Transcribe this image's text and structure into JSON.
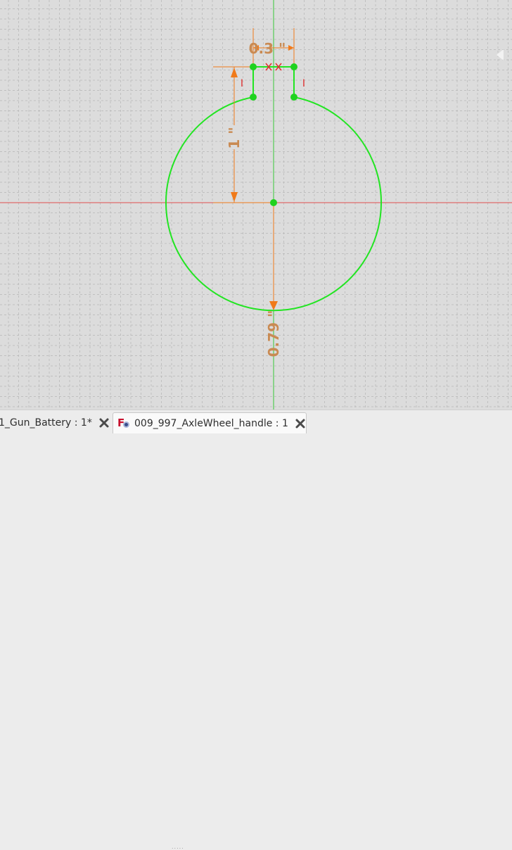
{
  "sketch": {
    "colors": {
      "background": "#dcdcdc",
      "grid": "#b5b5b5",
      "geometry": "#22e522",
      "vertex": "#1fd21f",
      "dimension": "#f07a1a",
      "dimension_text": "#c98a52",
      "x_axis": "#e05050",
      "y_axis": "#37c837",
      "constraint": "#e03030"
    },
    "dimensions": {
      "width_label": "0.3 \"",
      "height_label": "1 \"",
      "radius_label": "0.79 \""
    },
    "constraint_marks": {
      "left_vertical": "I",
      "right_vertical": "I"
    }
  },
  "tabs": [
    {
      "label": "1_Gun_Battery : 1*",
      "active": false,
      "icon": "close-icon"
    },
    {
      "label": "009_997_AxleWheel_handle : 1",
      "active": true,
      "icon": "freecad-document-icon"
    }
  ],
  "splitter_grip": "....."
}
